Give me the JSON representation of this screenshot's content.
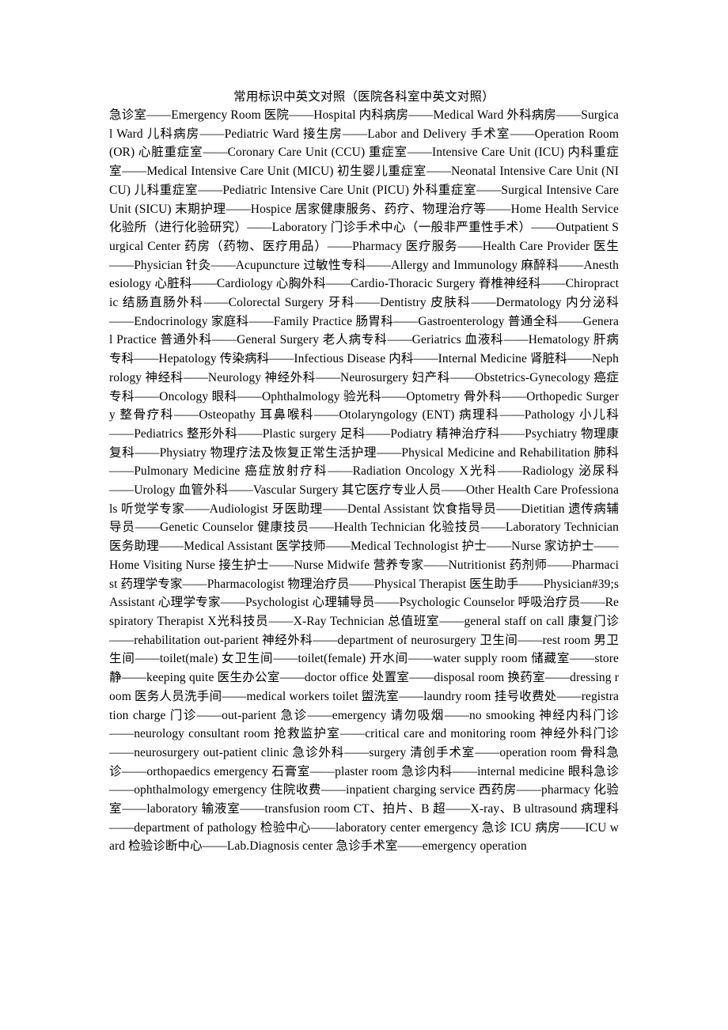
{
  "document": {
    "title": "常用标识中英文对照（医院各科室中英文对照）",
    "body": "急诊室——Emergency Room 医院——Hospital 内科病房——Medical Ward 外科病房——Surgical Ward 儿科病房——Pediatric Ward 接生房——Labor and Delivery 手术室——Operation Room (OR) 心脏重症室——Coronary Care Unit (CCU) 重症室——Intensive Care Unit (ICU) 内科重症室——Medical Intensive Care Unit (MICU) 初生婴儿重症室——Neonatal Intensive Care Unit (NICU) 儿科重症室——Pediatric Intensive Care Unit (PICU) 外科重症室——Surgical Intensive Care Unit (SICU) 末期护理——Hospice 居家健康服务、药疗、物理治疗等——Home Health Service 化验所（进行化验研究）——Laboratory 门诊手术中心（一般非严重性手术）——Outpatient Surgical Center 药房（药物、医疗用品）——Pharmacy 医疗服务——Health Care Provider 医生——Physician 针灸——Acupuncture 过敏性专科——Allergy and Immunology 麻醉科——Anesthesiology 心脏科——Cardiology 心胸外科——Cardio-Thoracic Surgery 脊椎神经科——Chiropractic 结肠直肠外科——Colorectal Surgery 牙科——Dentistry 皮肤科——Dermatology 内分泌科——Endocrinology 家庭科——Family Practice 肠胃科——Gastroenterology 普通全科——General Practice 普通外科——General Surgery 老人病专科——Geriatrics 血液科——Hematology 肝病专科——Hepatology 传染病科——Infectious Disease 内科——Internal Medicine 肾脏科——Nephrology 神经科——Neurology 神经外科——Neurosurgery 妇产科——Obstetrics-Gynecology 癌症专科——Oncology 眼科——Ophthalmology 验光科——Optometry 骨外科——Orthopedic Surgery 整骨疗科——Osteopathy 耳鼻喉科——Otolaryngology (ENT) 病理科——Pathology 小儿科——Pediatrics 整形外科——Plastic surgery 足科——Podiatry 精神治疗科——Psychiatry 物理康复科——Physiatry 物理疗法及恢复正常生活护理——Physical Medicine and Rehabilitation 肺科——Pulmonary Medicine 癌症放射疗科——Radiation Oncology X光科——Radiology 泌尿科——Urology 血管外科——Vascular Surgery 其它医疗专业人员——Other Health Care Professionals 听觉学专家——Audiologist 牙医助理——Dental Assistant 饮食指导员——Dietitian 遗传病辅导员——Genetic Counselor 健康技员——Health Technician 化验技员——Laboratory Technician 医务助理——Medical Assistant 医学技师——Medical Technologist 护士——Nurse 家访护士——Home Visiting Nurse 接生护士——Nurse Midwife 营养专家——Nutritionist 药剂师——Pharmacist 药理学专家——Pharmacologist 物理治疗员——Physical Therapist 医生助手——Physician#39;s Assistant 心理学专家——Psychologist 心理辅导员——Psychologic Counselor 呼吸治疗员——Respiratory Therapist X光科技员——X-Ray Technician 总值班室——general staff on call 康复门诊——rehabilitation out-parient 神经外科——department of neurosurgery 卫生间——rest room 男卫生间——toilet(male) 女卫生间——toilet(female) 开水间——water supply room 储藏室——store 静——keeping quite 医生办公室——doctor office 处置室——disposal room 换药室——dressing room 医务人员洗手间——medical workers toilet 盥洗室——laundry room 挂号收费处——registration charge 门诊——out-parient 急诊——emergency 请勿吸烟——no smooking 神经内科门诊——neurology consultant room 抢救监护室——critical care and monitoring room 神经外科门诊——neurosurgery out-patient clinic 急诊外科——surgery 清创手术室——operation room 骨科急诊——orthopaedics emergency 石膏室——plaster room 急诊内科——internal medicine 眼科急诊——ophthalmology emergency 住院收费——inpatient charging service 西药房——pharmacy 化验室——laboratory 输液室——transfusion room CT、拍片、B 超——X-ray、B ultrasound 病理科——department of pathology 检验中心——laboratory center emergency 急诊 ICU 病房——ICU ward 检验诊断中心——Lab.Diagnosis center 急诊手术室——emergency operation"
  }
}
